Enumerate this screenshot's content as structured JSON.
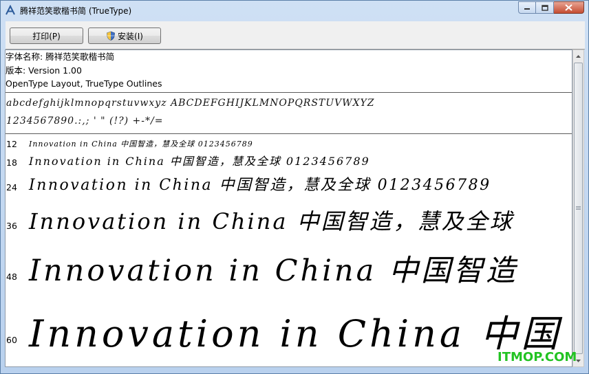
{
  "window": {
    "title": "腾祥范笑歌楷书简 (TrueType)",
    "icons": {
      "app": "font-a-icon",
      "minimize": "minimize-icon",
      "maximize": "maximize-icon",
      "close": "close-icon"
    }
  },
  "toolbar": {
    "print_label": "打印(P)",
    "install_label": "安装(I)",
    "install_icon": "uac-shield-icon"
  },
  "info": {
    "font_name": "字体名称: 腾祥范笑歌楷书简",
    "version": "版本: Version 1.00",
    "type": "OpenType Layout, TrueType Outlines"
  },
  "charset": {
    "letters": "abcdefghijklmnopqrstuvwxyz ABCDEFGHIJKLMNOPQRSTUVWXYZ",
    "digits": "1234567890.:,; ' \" (!?) +-*/="
  },
  "samples": [
    {
      "size": "12",
      "text": "Innovation in China 中国智造，慧及全球 0123456789"
    },
    {
      "size": "18",
      "text": "Innovation in China 中国智造，慧及全球 0123456789"
    },
    {
      "size": "24",
      "text": "Innovation in China 中国智造，慧及全球 0123456789"
    },
    {
      "size": "36",
      "text": "Innovation in China 中国智造，慧及全球"
    },
    {
      "size": "48",
      "text": "Innovation in China 中国智造"
    },
    {
      "size": "60",
      "text": "Innovation in China 中国"
    }
  ],
  "watermark": "ITMOP.COM",
  "colors": {
    "watermark": "#22c322",
    "close_button": "#c54d33"
  }
}
